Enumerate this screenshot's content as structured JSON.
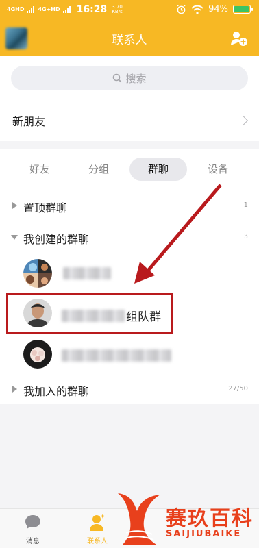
{
  "status_bar": {
    "signal1": "4GHD",
    "signal2": "4G+HD",
    "time": "16:28",
    "net_speed_value": "3.70",
    "net_speed_unit": "KB/s",
    "battery": "94%",
    "battery_level": 0.94,
    "icons": [
      "alarm-icon",
      "wifi-icon",
      "battery-icon"
    ]
  },
  "header": {
    "title": "联系人",
    "right_icon": "add-contact-icon"
  },
  "search": {
    "placeholder": "搜索",
    "icon": "search-icon"
  },
  "new_friends": {
    "label": "新朋友",
    "icon": "chevron-right-icon"
  },
  "tabs": [
    {
      "label": "好友",
      "active": false
    },
    {
      "label": "分组",
      "active": false
    },
    {
      "label": "群聊",
      "active": true
    },
    {
      "label": "设备",
      "active": false
    }
  ],
  "groups": [
    {
      "label": "置顶群聊",
      "count": "1",
      "expanded": false
    },
    {
      "label": "我创建的群聊",
      "count": "3",
      "expanded": true
    },
    {
      "label": "我加入的群聊",
      "count": "27/50",
      "expanded": false
    }
  ],
  "created_chats": [
    {
      "name_suffix": ""
    },
    {
      "name_suffix": "组队群"
    },
    {
      "name_suffix": ""
    }
  ],
  "bottom_nav": [
    {
      "label": "消息",
      "icon": "message-icon",
      "active": false
    },
    {
      "label": "联系人",
      "icon": "contacts-icon",
      "active": true
    }
  ],
  "watermark": {
    "text": "赛玖百科",
    "sub": "SAIJIUBAIKE"
  },
  "colors": {
    "accent": "#f7b824",
    "highlight": "#b91a1d",
    "watermark": "#e8401c"
  }
}
